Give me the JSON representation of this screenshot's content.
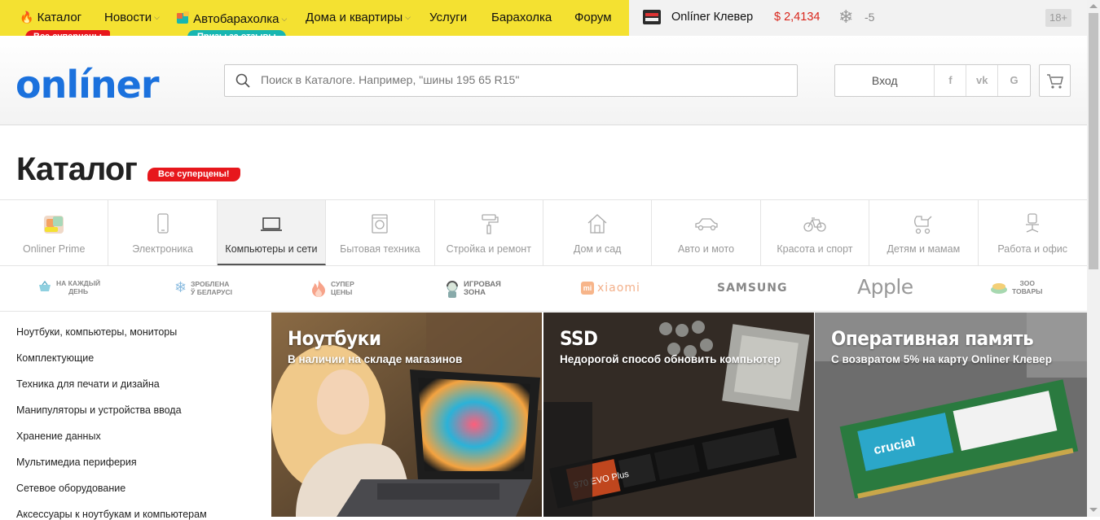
{
  "topbar": {
    "nav": [
      {
        "label": "Каталог",
        "dropdown": false
      },
      {
        "label": "Новости",
        "dropdown": true
      },
      {
        "label": "Автобарахолка",
        "dropdown": true
      },
      {
        "label": "Дома и квартиры",
        "dropdown": true
      },
      {
        "label": "Услуги",
        "dropdown": false
      },
      {
        "label": "Барахолка",
        "dropdown": false
      },
      {
        "label": "Форум",
        "dropdown": false
      }
    ],
    "badge_catalog": "Все суперцены",
    "badge_auto": "Призы за отзывы",
    "clever": "Onlíner Клевер",
    "currency": "$ 2,4134",
    "weather": "-5",
    "age": "18+",
    "colors": {
      "yellow": "#f4e131",
      "red": "#e7171c",
      "teal": "#17b6b1",
      "currency": "#d9261c"
    }
  },
  "header": {
    "logo": "onlíner",
    "search_placeholder": "Поиск в Каталоге. Например, \"шины 195 65 R15\"",
    "login": "Вход",
    "social": [
      "f",
      "vk",
      "G"
    ]
  },
  "page": {
    "title": "Каталог",
    "title_badge": "Все суперцены!"
  },
  "categories": [
    {
      "label": "Onliner Prime",
      "icon": "prime-icon",
      "active": false
    },
    {
      "label": "Электроника",
      "icon": "smartphone-icon",
      "active": false
    },
    {
      "label": "Компьютеры и сети",
      "icon": "laptop-icon",
      "active": true
    },
    {
      "label": "Бытовая техника",
      "icon": "washing-machine-icon",
      "active": false
    },
    {
      "label": "Стройка и ремонт",
      "icon": "paint-roller-icon",
      "active": false
    },
    {
      "label": "Дом и сад",
      "icon": "house-icon",
      "active": false
    },
    {
      "label": "Авто и мото",
      "icon": "car-icon",
      "active": false
    },
    {
      "label": "Красота и спорт",
      "icon": "bicycle-icon",
      "active": false
    },
    {
      "label": "Детям и мамам",
      "icon": "stroller-icon",
      "active": false
    },
    {
      "label": "Работа и офис",
      "icon": "office-chair-icon",
      "active": false
    }
  ],
  "promos": [
    {
      "line1": "На каждый",
      "line2": "день",
      "icon": "basket-icon"
    },
    {
      "line1": "Зроблена",
      "line2": "ў Беларусі",
      "icon": "snowflake-icon"
    },
    {
      "line1": "Супер",
      "line2": "цены",
      "icon": "flame-icon"
    },
    {
      "line1": "Игровая",
      "line2": "зона",
      "icon": "gamer-icon"
    },
    {
      "brand": "xiaomi",
      "icon": "xiaomi-logo"
    },
    {
      "brand": "SAMSUNG",
      "icon": "samsung-logo"
    },
    {
      "brand": "Apple",
      "icon": "apple-logo"
    },
    {
      "line1": "Зоо",
      "line2": "товары",
      "icon": "pet-bowl-icon"
    }
  ],
  "sidebar": [
    "Ноутбуки, компьютеры, мониторы",
    "Комплектующие",
    "Техника для печати и дизайна",
    "Манипуляторы и устройства ввода",
    "Хранение данных",
    "Мультимедиа периферия",
    "Сетевое оборудование",
    "Аксессуары к ноутбукам и компьютерам"
  ],
  "tiles": [
    {
      "title": "Ноутбуки",
      "subtitle": "В наличии на складе магазинов"
    },
    {
      "title": "SSD",
      "subtitle": "Недорогой способ обновить компьютер"
    },
    {
      "title": "Оперативная память",
      "subtitle": "С возвратом 5% на карту Onliner Клевер"
    }
  ]
}
